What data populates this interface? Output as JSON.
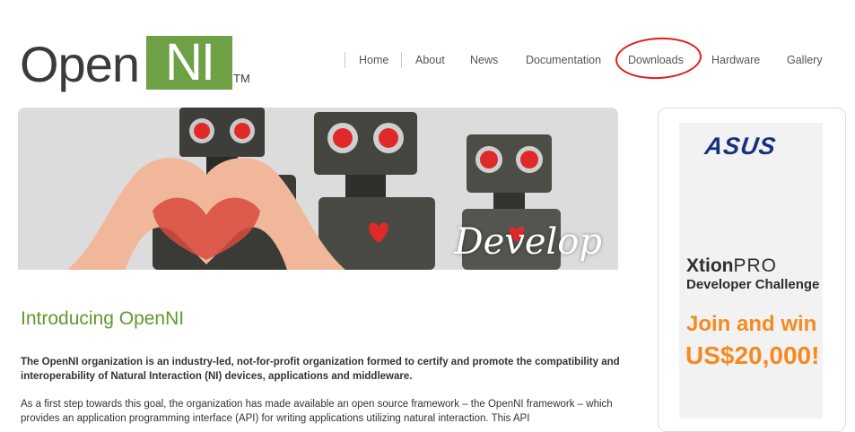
{
  "logo": {
    "open_text": "Open",
    "ni_text": "NI",
    "tm_text": "TM",
    "brand_green": "#6ea046"
  },
  "nav": {
    "items": [
      {
        "label": "Home"
      },
      {
        "label": "About"
      },
      {
        "label": "News"
      },
      {
        "label": "Documentation"
      },
      {
        "label": "Downloads"
      },
      {
        "label": "Hardware"
      },
      {
        "label": "Gallery"
      }
    ],
    "highlight_color": "#e21b1b"
  },
  "banner": {
    "caption": "Develop"
  },
  "content": {
    "title": "Introducing OpenNI",
    "paragraph1": "The OpenNI organization is an industry-led, not-for-profit organization formed to certify and promote the compatibility and interoperability of Natural Interaction (NI) devices, applications and middleware.",
    "paragraph2": "As a first step towards this goal, the organization has made available an open source framework – the OpenNI framework – which provides an application programming interface (API) for writing applications utilizing natural interaction. This API"
  },
  "sidebar_ad": {
    "brand": "ASUS",
    "product_xtion": "Xtion",
    "product_pro": "PRO",
    "subtitle": "Developer Challenge",
    "cta": "Join and win",
    "prize": "US$20,000!",
    "accent_color": "#f58a1f"
  }
}
